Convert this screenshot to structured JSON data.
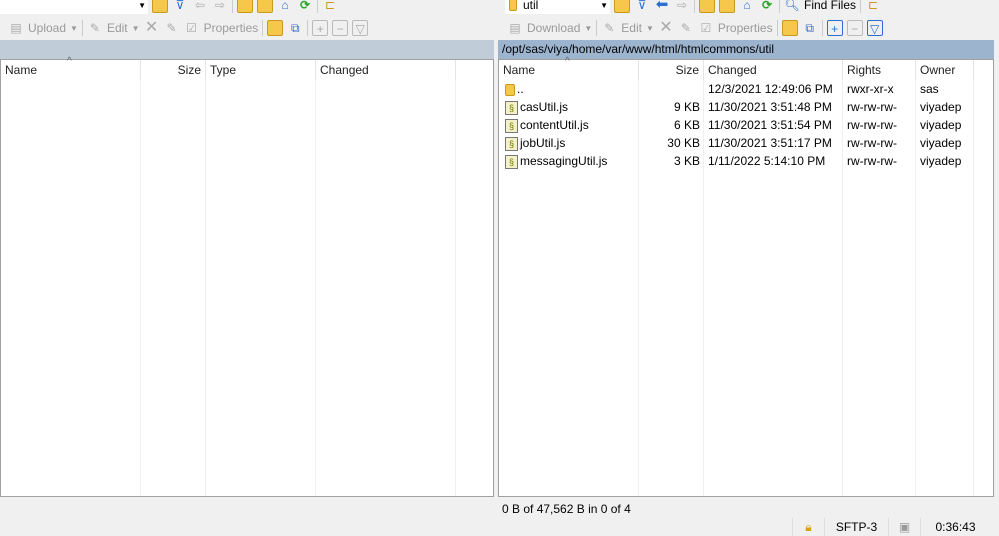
{
  "left": {
    "path": "",
    "location": "",
    "toolbar": {
      "upload": "Upload",
      "edit": "Edit",
      "properties": "Properties"
    },
    "columns": [
      "Name",
      "Size",
      "Type",
      "Changed"
    ],
    "rows": []
  },
  "right": {
    "location": "util",
    "find_files": "Find Files",
    "path": "/opt/sas/viya/home/var/www/html/htmlcommons/util",
    "toolbar": {
      "download": "Download",
      "edit": "Edit",
      "properties": "Properties"
    },
    "columns": [
      "Name",
      "Size",
      "Changed",
      "Rights",
      "Owner"
    ],
    "rows": [
      {
        "name": "..",
        "size": "",
        "changed": "12/3/2021 12:49:06 PM",
        "rights": "rwxr-xr-x",
        "owner": "sas",
        "icon": "parent-folder-icon"
      },
      {
        "name": "casUtil.js",
        "size": "9 KB",
        "changed": "11/30/2021 3:51:48 PM",
        "rights": "rw-rw-rw-",
        "owner": "viyadep",
        "icon": "js-file-icon"
      },
      {
        "name": "contentUtil.js",
        "size": "6 KB",
        "changed": "11/30/2021 3:51:54 PM",
        "rights": "rw-rw-rw-",
        "owner": "viyadep",
        "icon": "js-file-icon"
      },
      {
        "name": "jobUtil.js",
        "size": "30 KB",
        "changed": "11/30/2021 3:51:17 PM",
        "rights": "rw-rw-rw-",
        "owner": "viyadep",
        "icon": "js-file-icon"
      },
      {
        "name": "messagingUtil.js",
        "size": "3 KB",
        "changed": "1/11/2022 5:14:10 PM",
        "rights": "rw-rw-rw-",
        "owner": "viyadep",
        "icon": "js-file-icon"
      }
    ],
    "summary": "0 B of 47,562 B in 0 of 4"
  },
  "statusbar": {
    "protocol": "SFTP-3",
    "time": "0:36:43"
  }
}
